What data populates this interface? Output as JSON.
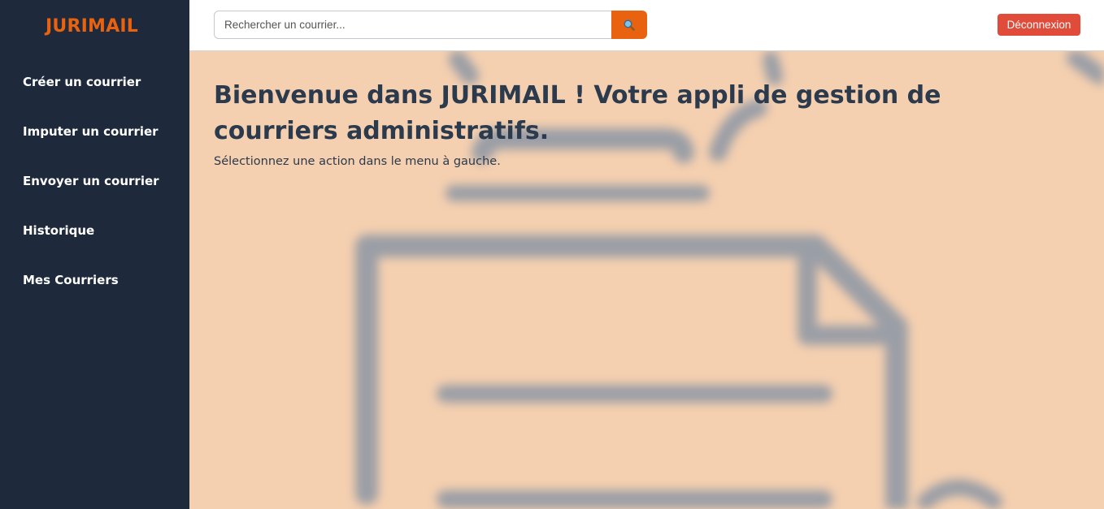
{
  "app": {
    "brand": "JURIMAIL"
  },
  "sidebar": {
    "items": [
      {
        "label": "Créer un courrier"
      },
      {
        "label": "Imputer un courrier"
      },
      {
        "label": "Envoyer un courrier"
      },
      {
        "label": "Historique"
      },
      {
        "label": "Mes Courriers"
      }
    ]
  },
  "topbar": {
    "search": {
      "placeholder": "Rechercher un courrier...",
      "value": "",
      "button_icon": "search-icon"
    },
    "logout_label": "Déconnexion"
  },
  "main": {
    "title": "Bienvenue dans JURIMAIL ! Votre appli de gestion de courriers administratifs.",
    "subtitle": "Sélectionnez une action dans le menu à gauche.",
    "background_icon": "document-icon"
  },
  "colors": {
    "sidebar_bg": "#1e2a3b",
    "accent": "#e8620f",
    "danger": "#e04b3a",
    "main_bg": "#f5d0b0",
    "text_dark": "#2b3a4c"
  }
}
